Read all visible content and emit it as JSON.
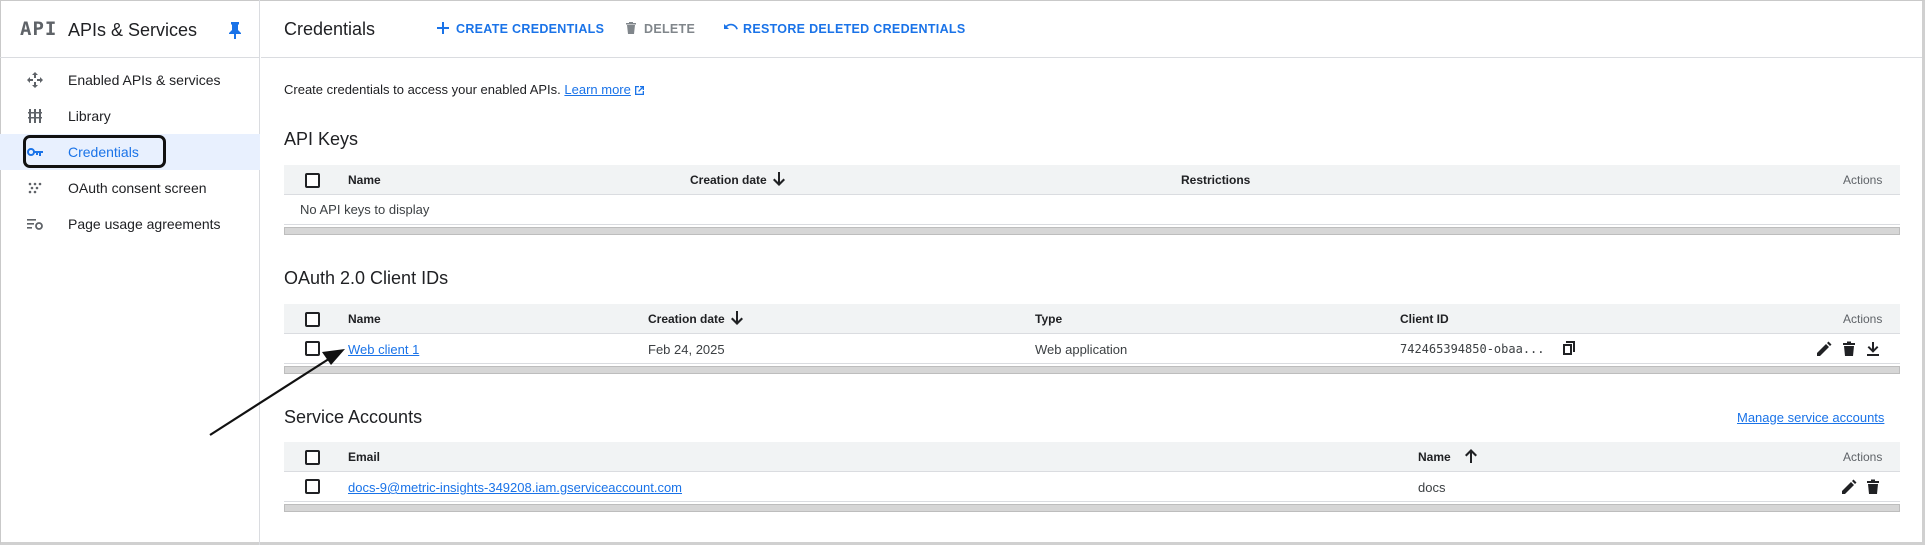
{
  "sidebar": {
    "logo": "API",
    "title": "APIs & Services",
    "items": [
      {
        "label": "Enabled APIs & services",
        "icon": "diamond-arrows-icon"
      },
      {
        "label": "Library",
        "icon": "library-icon"
      },
      {
        "label": "Credentials",
        "icon": "key-icon",
        "active": true
      },
      {
        "label": "OAuth consent screen",
        "icon": "dots-grid-icon"
      },
      {
        "label": "Page usage agreements",
        "icon": "settings-list-icon"
      }
    ]
  },
  "header": {
    "title": "Credentials",
    "create_label": "CREATE CREDENTIALS",
    "delete_label": "DELETE",
    "restore_label": "RESTORE DELETED CREDENTIALS"
  },
  "intro": {
    "text": "Create credentials to access your enabled APIs.",
    "link": "Learn more"
  },
  "api_keys": {
    "title": "API Keys",
    "columns": [
      "Name",
      "Creation date",
      "Restrictions",
      "Actions"
    ],
    "empty_text": "No API keys to display"
  },
  "oauth": {
    "title": "OAuth 2.0 Client IDs",
    "columns": [
      "Name",
      "Creation date",
      "Type",
      "Client ID",
      "Actions"
    ],
    "rows": [
      {
        "name": "Web client 1",
        "date": "Feb 24, 2025",
        "type": "Web application",
        "client_id": "742465394850-obaa..."
      }
    ]
  },
  "service_accounts": {
    "title": "Service Accounts",
    "manage_label": "Manage service accounts",
    "columns": [
      "Email",
      "Name",
      "Actions"
    ],
    "rows": [
      {
        "email": "docs-9@metric-insights-349208.iam.gserviceaccount.com",
        "name": "docs"
      }
    ]
  },
  "colors": {
    "accent": "#1a73e8",
    "active_bg": "#e8f0fe",
    "header_bg": "#f1f3f4"
  }
}
